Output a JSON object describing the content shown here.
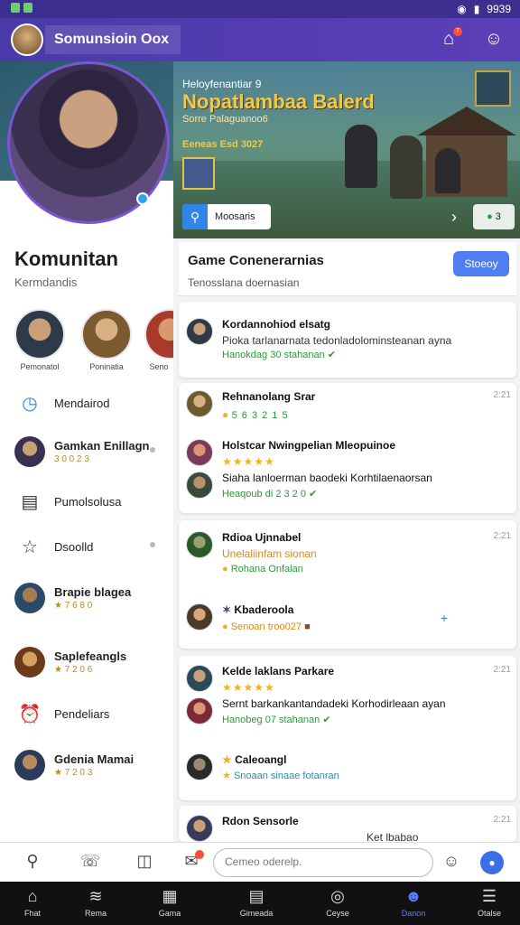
{
  "statusbar": {
    "time": "9939"
  },
  "topbar": {
    "title": "Somunsioin Oox",
    "notif_count": "7"
  },
  "banner": {
    "line1": "Heloyfenantiar 9",
    "headline": "Nopatlambaa Balerd",
    "line3": "Sorre Palaguanoo6",
    "line4": "Eeneas Esd 3027",
    "search_label": "Moosaris",
    "count_value": "3"
  },
  "sidebar": {
    "title": "Komunitan",
    "subtitle": "Kermdandis",
    "friends": [
      {
        "name": "Pemonatol"
      },
      {
        "name": "Poninatia"
      },
      {
        "name": "Seno"
      }
    ],
    "items": [
      {
        "label": "Mendairod",
        "sub": ""
      },
      {
        "label": "Gamkan Enillagn",
        "sub": "3 0 0 2 3"
      },
      {
        "label": "Pumolsolusa",
        "sub": ""
      },
      {
        "label": "Dsoolld",
        "sub": ""
      },
      {
        "label": "Brapie blagea",
        "sub": "★ 7 6 8 0"
      },
      {
        "label": "Saplefeangls",
        "sub": "★ 7 2 0 6"
      },
      {
        "label": "Pendeliars",
        "sub": ""
      },
      {
        "label": "Gdenia Mamai",
        "sub": "★ 7 2 0 3"
      }
    ]
  },
  "main": {
    "header": {
      "title": "Game Conenerarnias",
      "subtitle": "Tenosslana doernasian",
      "button": "Stoeoy"
    },
    "posts": [
      {
        "title": "Kordannohiod elsatg",
        "body": "Pioka tarlanarnata tedonladolominsteanan ayna",
        "meta": "Hanokdag 30 stahanan"
      },
      {
        "title": "Rehnanolang Srar",
        "body": "",
        "meta": "5 6 3 2 1 5",
        "time": "2:21"
      },
      {
        "title": "Holstcar Nwingpelian Mleopuinoe",
        "body": "",
        "meta": "",
        "time": ""
      },
      {
        "title": "",
        "body": "Siaha lanloerman baodeki Korhtilaenaorsan",
        "meta": "Heaqoub di 2 3 2 0",
        "time": ""
      },
      {
        "title": "Rdioa Ujnnabel",
        "body": "Unelaliinfam sionan",
        "meta": "Rohana Onfalan",
        "time": "2:21"
      },
      {
        "title": "Kbaderoola",
        "body": "",
        "meta": "Senoan troo027",
        "time": ""
      },
      {
        "title": "Kelde laklans Parkare",
        "body": "",
        "meta": "",
        "time": "2:21"
      },
      {
        "title": "",
        "body": "Sernt barkankantandadeki Korhodirleaan ayan",
        "meta": "Hanobeg 07 stahanan",
        "time": ""
      },
      {
        "title": "Caleoangl",
        "body": "",
        "meta": "Snoaan sinaae fotanran",
        "time": ""
      },
      {
        "title": "Rdon Sensorle",
        "body": "Ket lbabao",
        "meta": "",
        "time": "2:21"
      }
    ]
  },
  "composer": {
    "placeholder": "Cemeo oderelp."
  },
  "tabs": [
    {
      "label": "Fhat"
    },
    {
      "label": "Rema"
    },
    {
      "label": "Gama"
    },
    {
      "label": "Gimeada"
    },
    {
      "label": "Ceyse"
    },
    {
      "label": "Danon"
    },
    {
      "label": "Otalse"
    }
  ],
  "colors": {
    "accent": "#4d7ff1",
    "topbar": "#4a3aa8",
    "green": "#2a9a3a",
    "gold": "#f3b21a"
  }
}
